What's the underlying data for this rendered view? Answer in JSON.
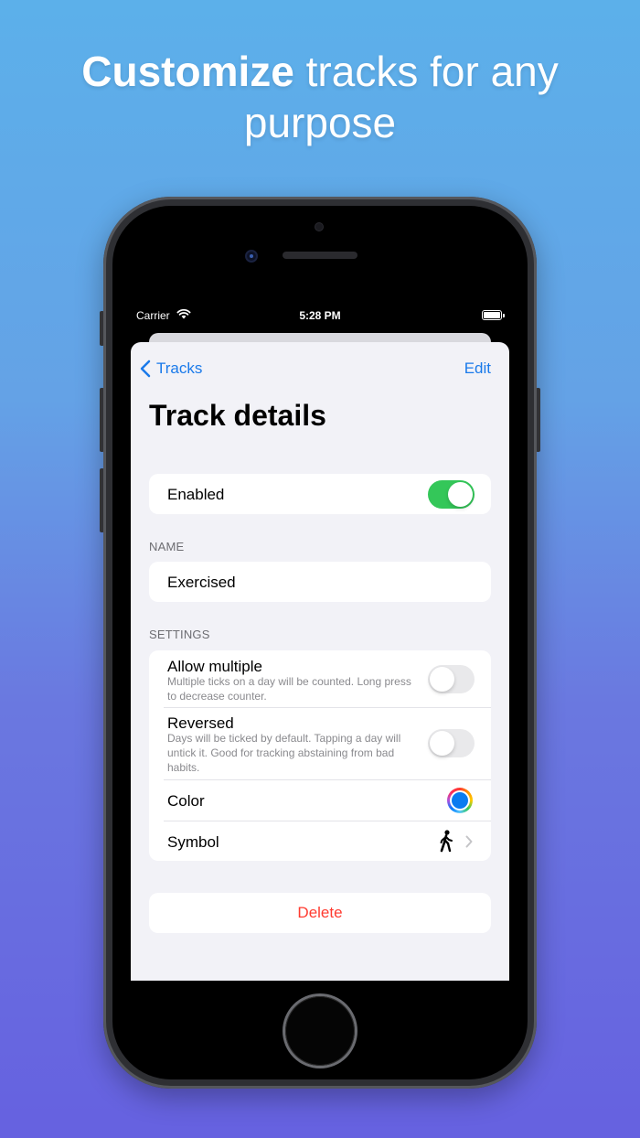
{
  "headline": {
    "bold": "Customize",
    "rest": " tracks for any purpose"
  },
  "statusbar": {
    "carrier": "Carrier",
    "time": "5:28 PM"
  },
  "nav": {
    "back_label": "Tracks",
    "edit_label": "Edit"
  },
  "page_title": "Track details",
  "enabled": {
    "label": "Enabled",
    "on": true
  },
  "name_section": {
    "header": "NAME",
    "value": "Exercised"
  },
  "settings_section": {
    "header": "SETTINGS",
    "allow_multiple": {
      "label": "Allow multiple",
      "description": "Multiple ticks on a day will be counted. Long press to decrease counter.",
      "on": false
    },
    "reversed": {
      "label": "Reversed",
      "description": "Days will be ticked by default. Tapping a day will untick it. Good for tracking abstaining from bad habits.",
      "on": false
    },
    "color": {
      "label": "Color",
      "value": "#0a7bf0"
    },
    "symbol": {
      "label": "Symbol",
      "icon": "figure-walk-icon"
    }
  },
  "delete_label": "Delete",
  "colors": {
    "accent": "#1a7aea",
    "toggle_on": "#34c759",
    "destructive": "#ff3b30",
    "background": "#f2f2f7"
  }
}
